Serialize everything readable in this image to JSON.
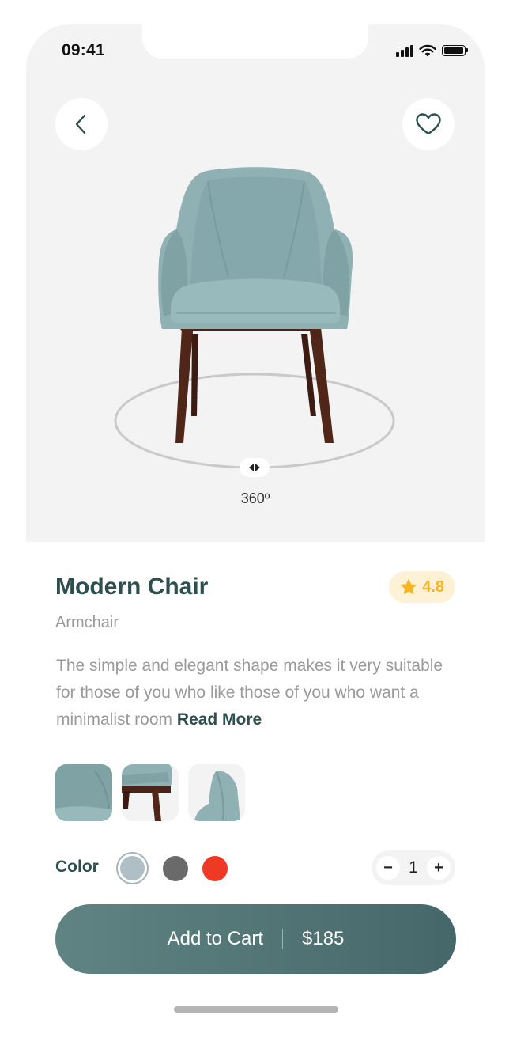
{
  "status_bar": {
    "time": "09:41",
    "icons": [
      "cellular-signal-icon",
      "wifi-icon",
      "battery-icon"
    ]
  },
  "header": {
    "back_icon": "chevron-left-icon",
    "favorite_icon": "heart-outline-icon"
  },
  "viewer": {
    "rotate_label": "360º",
    "rotate_handle_icon": "rotate-arrows-icon"
  },
  "product": {
    "name": "Modern Chair",
    "category": "Armchair",
    "rating": "4.8",
    "rating_icon": "star-icon",
    "description": "The simple and elegant shape makes it very suitable for those of you who like those of you who want a minimalist room",
    "read_more": "Read More"
  },
  "thumbnails": [
    "chair-arm-closeup",
    "chair-side-legs",
    "chair-back-detail"
  ],
  "colors": {
    "label": "Color",
    "options": [
      "#b0bfc6",
      "#6a6a6a",
      "#ee3a24"
    ],
    "selected": "#b0bfc6"
  },
  "quantity": {
    "value": "1",
    "minus": "−",
    "plus": "+"
  },
  "cart": {
    "label": "Add to Cart",
    "price": "$185"
  },
  "theme": {
    "primary": "#4f7372",
    "rating_bg": "#fdf1d6",
    "rating_fg": "#f6b420",
    "chair_fabric": "#8fb1b4",
    "chair_legs": "#4a2417"
  }
}
